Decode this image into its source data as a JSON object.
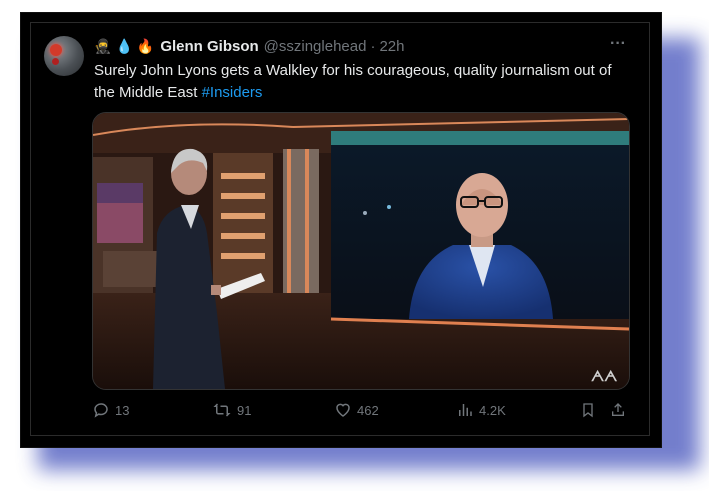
{
  "tweet": {
    "display_name": "Glenn Gibson",
    "handle": "@sszinglehead",
    "separator": "·",
    "time": "22h",
    "name_emojis": [
      "🥷",
      "💧",
      "🔥"
    ],
    "text_main": "Surely John Lyons gets a Walkley for his courageous, quality journalism out of the Middle East ",
    "hashtag": "#Insiders",
    "more_label": "···"
  },
  "media": {
    "description_icon": "video-still",
    "watermark": "abc-logo"
  },
  "actions": {
    "replies": "13",
    "reposts": "91",
    "likes": "462",
    "views": "4.2K"
  },
  "colors": {
    "background": "#000000",
    "text": "#e7e9ea",
    "muted": "#71767b",
    "link": "#1d9bf0",
    "shadow": "#5b68c4"
  }
}
